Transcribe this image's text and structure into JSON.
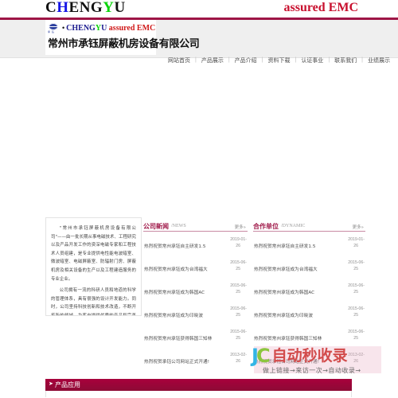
{
  "top": {
    "wordmark": {
      "part1": "C",
      "part2": "H",
      "part3": "ENG",
      "part4": "Y",
      "part5": "U"
    },
    "tagline": "assured EMC"
  },
  "logo": {
    "mark_sub": "承 钰",
    "dot": "•",
    "en_cheng": "CHENG",
    "en_y": "Y",
    "en_u": "U",
    "en_assured": "assured EMC",
    "cn": "常州市承钰屏蔽机房设备有限公司"
  },
  "nav": {
    "items": [
      "网站首页",
      "产品展示",
      "产品介绍",
      "资料下载",
      "认证事业",
      "联系我们",
      "业绩展示"
    ],
    "separator": "|"
  },
  "about": {
    "paragraphs": [
      "\"常州市承钰屏蔽机房设备有限公司\"——由一批长期从事电磁技术、工程研究以及产品开发工作的资深电磁专家和工程技术人员组建，是专业提供电性能电波暗室、微波暗室、电磁屏蔽室、防辐射门房、屏蔽机房及相关设备的生产以及工程建造服务的专业企业。",
      "公司拥有一流的科研人员和地道的科学的管理体系，具有很强的设计开发能力。同时，公司坚持科技创新和技术改造，不断开拓新的领域，为客户提供优质的产品和完善的服务，推动电子科技的发展。"
    ]
  },
  "news": {
    "title": "公司新闻",
    "subtitle": "/NEWS",
    "more": "更多»",
    "items": [
      {
        "title": "热烈祝贺常州承钰自主研发1.5",
        "date_top": "2019-01-",
        "date_bottom": "26"
      },
      {
        "title": "热烈祝贺常州承钰成为台湾福大",
        "date_top": "2015-06-",
        "date_bottom": "25"
      },
      {
        "title": "热烈祝贺常州承钰成为韩国AC",
        "date_top": "2015-06-",
        "date_bottom": "25"
      },
      {
        "title": "热烈祝贺常州承钰成为印晓波",
        "date_top": "2015-06-",
        "date_bottom": "25"
      },
      {
        "title": "热烈祝贺常州承钰获得韩国三知林",
        "date_top": "2015-06-",
        "date_bottom": "25"
      },
      {
        "title": "热烈祝贺承钰公司网站正式开通!",
        "date_top": "2013-02-",
        "date_bottom": "26"
      }
    ]
  },
  "partner": {
    "title": "合作单位",
    "subtitle": "/DYNAMIC",
    "more": "更多»",
    "items": [
      {
        "title": "热烈祝贺常州承钰自主研发1.5",
        "date_top": "2019-01-",
        "date_bottom": "26"
      },
      {
        "title": "热烈祝贺常州承钰成为台湾福大",
        "date_top": "2015-06-",
        "date_bottom": "25"
      },
      {
        "title": "热烈祝贺常州承钰成为韩国AC",
        "date_top": "2015-06-",
        "date_bottom": "25"
      },
      {
        "title": "热烈祝贺常州承钰成为印晓波",
        "date_top": "2015-06-",
        "date_bottom": "25"
      },
      {
        "title": "热烈祝贺常州承钰获得韩国三知林",
        "date_top": "2015-06-",
        "date_bottom": "25"
      },
      {
        "title": "热烈祝贺承钰公司网站正式开通!",
        "date_top": "2013-02-",
        "date_bottom": "26"
      }
    ]
  },
  "product_bar": {
    "arrow": "➤",
    "label": "产品应用"
  },
  "watermark": {
    "logo_j": "J",
    "logo_c": "C",
    "logo_cn": "自动秒收录",
    "tagline": "做上链接→来访一次→自动收录→"
  },
  "colors": {
    "crimson": "#9e1546",
    "product_bar": "#a8003c",
    "tagline_red": "#c8102e",
    "nav_text": "#4a4a4a",
    "header_bg": "#efefef"
  }
}
